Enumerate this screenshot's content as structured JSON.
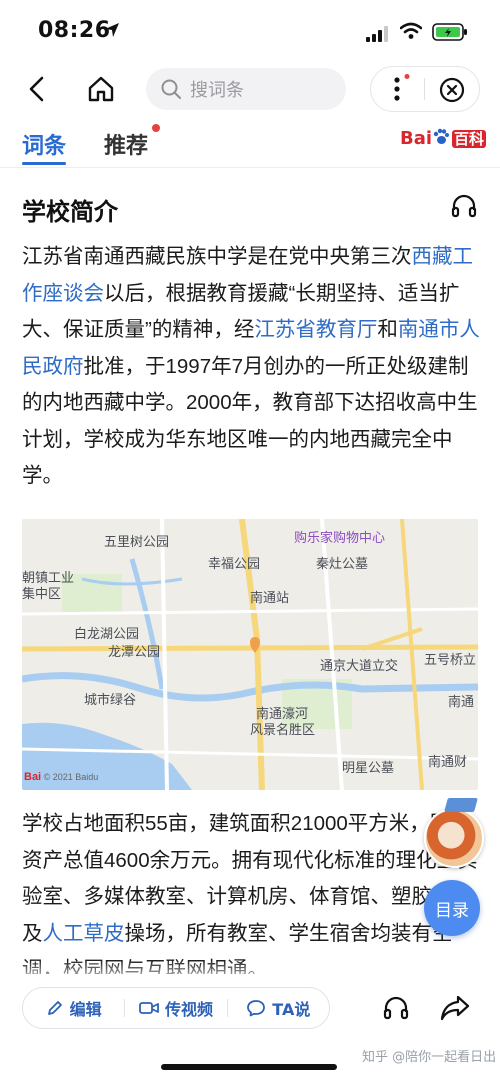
{
  "status": {
    "time": "08:26"
  },
  "nav": {
    "search_placeholder": "搜词条"
  },
  "tabs": [
    {
      "label": "词条",
      "active": true
    },
    {
      "label": "推荐",
      "badge": true
    }
  ],
  "brand": {
    "logo_text": "Bai",
    "logo_tail": "百科"
  },
  "section": {
    "title": "学校简介"
  },
  "para1": {
    "s1": "江苏省南通西藏民族中学是在党中央第三次",
    "l1": "西藏工作座谈会",
    "s2": "以后，根据教育援藏“长期坚持、适当扩大、保证质量”的精神，经",
    "l2": "江苏省教育厅",
    "s3": "和",
    "l3": "南通市人民政府",
    "s4": "批准，于1997年7月创办的一所正处级建制的内地西藏中学。2000年，教育部下达招收高中生计划，学校成为华东地区唯一的内地西藏完全中学。"
  },
  "map": {
    "labels": {
      "wulishu": "五里树公园",
      "gouwu": "购乐家购物中心",
      "xingfu": "幸福公园",
      "qinzao": "秦灶公墓",
      "chaozhen1": "朝镇工业",
      "chaozhen2": "集中区",
      "nantong_station": "南通站",
      "bailonghu": "白龙湖公园",
      "longtan": "龙潭公园",
      "tongjing": "通京大道立交",
      "wuhao": "五号桥立",
      "chengshi": "城市绿谷",
      "nantong_right": "南通",
      "haohe1": "南通濠河",
      "haohe2": "风景名胜区",
      "mingxing": "明星公墓",
      "nantongcai": "南通财"
    },
    "copyright": "© 2021 Baidu",
    "copyright_brand": "Bai"
  },
  "para2": {
    "s1": "学校占地面积55亩，建筑面积21000平方米，固定资产总值4600余万元。拥有现代化标准的理化生实验室、多媒体教室、计算机房、体育馆、塑胶跑道及",
    "l1": "人工草皮",
    "s2": "操场，所有教室、学生宿舍均装有空调，校园网与互联网相通。"
  },
  "toc": {
    "label": "目录"
  },
  "actions": {
    "edit": "编辑",
    "video": "传视频",
    "ta": "TA说"
  },
  "watermark": "知乎 @陪你一起看日出",
  "colors": {
    "link": "#2f6cc6",
    "accent": "#2a6bd1",
    "brand_red": "#d8262c"
  }
}
